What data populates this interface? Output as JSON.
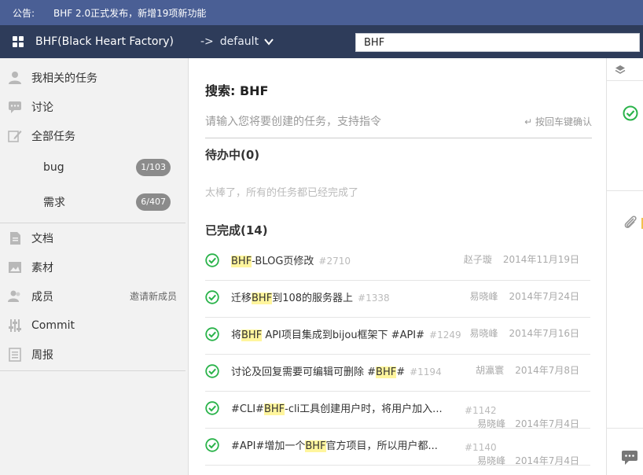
{
  "announcement": {
    "label": "公告:",
    "text": "BHF 2.0正式发布，新增19项新功能"
  },
  "header": {
    "app_title": "BHF(Black Heart Factory)",
    "project_arrow": "->",
    "project_name": "default",
    "search_value": "BHF"
  },
  "sidebar": {
    "my_tasks": "我相关的任务",
    "discussion": "讨论",
    "all_tasks": "全部任务",
    "bug": {
      "label": "bug",
      "count": "1/103"
    },
    "requirement": {
      "label": "需求",
      "count": "6/407"
    },
    "docs": "文档",
    "assets": "素材",
    "members": "成员",
    "invite": "邀请新成员",
    "commit": "Commit",
    "weekly": "周报"
  },
  "main": {
    "search_label": "搜索: BHF",
    "create_placeholder": "请输入您将要创建的任务，支持指令",
    "enter_hint": "↵ 按回车键确认",
    "pending_title": "待办中(0)",
    "empty_msg": "太棒了，所有的任务都已经完成了",
    "done_title": "已完成(14)"
  },
  "tasks": [
    {
      "pre": "",
      "hl": "BHF",
      "post": "-BLOG页修改",
      "num": "#2710",
      "who": "赵子璇",
      "date": "2014年11月19日"
    },
    {
      "pre": "迁移",
      "hl": "BHF",
      "post": "到108的服务器上",
      "num": "#1338",
      "who": "易晓峰",
      "date": "2014年7月24日"
    },
    {
      "pre": "将",
      "hl": "BHF",
      "post": " API项目集成到bijou框架下 #API#",
      "num": "#1249",
      "who": "易晓峰",
      "date": "2014年7月16日"
    },
    {
      "pre": "讨论及回复需要可编辑可删除 #",
      "hl": "BHF",
      "post": "#",
      "num": "#1194",
      "who": "胡瀛寰",
      "date": "2014年7月8日"
    },
    {
      "pre": "#CLI#",
      "hl": "BHF",
      "post": "-cli工具创建用户时，将用户加入...",
      "num": "#1142",
      "who": "易晓峰",
      "date": "2014年7月4日"
    },
    {
      "pre": "#API#增加一个",
      "hl": "BHF",
      "post": "官方项目，所以用户都...",
      "num": "#1140",
      "who": "易晓峰",
      "date": "2014年7月4日"
    }
  ],
  "colors": {
    "announce_bg": "#4a5f95",
    "topbar_bg": "#2e3c5a",
    "check_green": "#2ab34a",
    "highlight": "#fff59d"
  },
  "icons": [
    "grid-icon",
    "chevron-down-icon",
    "person-icon",
    "chat-icon",
    "edit-icon",
    "doc-icon",
    "image-icon",
    "members-icon",
    "commit-icon",
    "report-icon",
    "check-circle-icon",
    "layers-icon",
    "paperclip-icon"
  ]
}
